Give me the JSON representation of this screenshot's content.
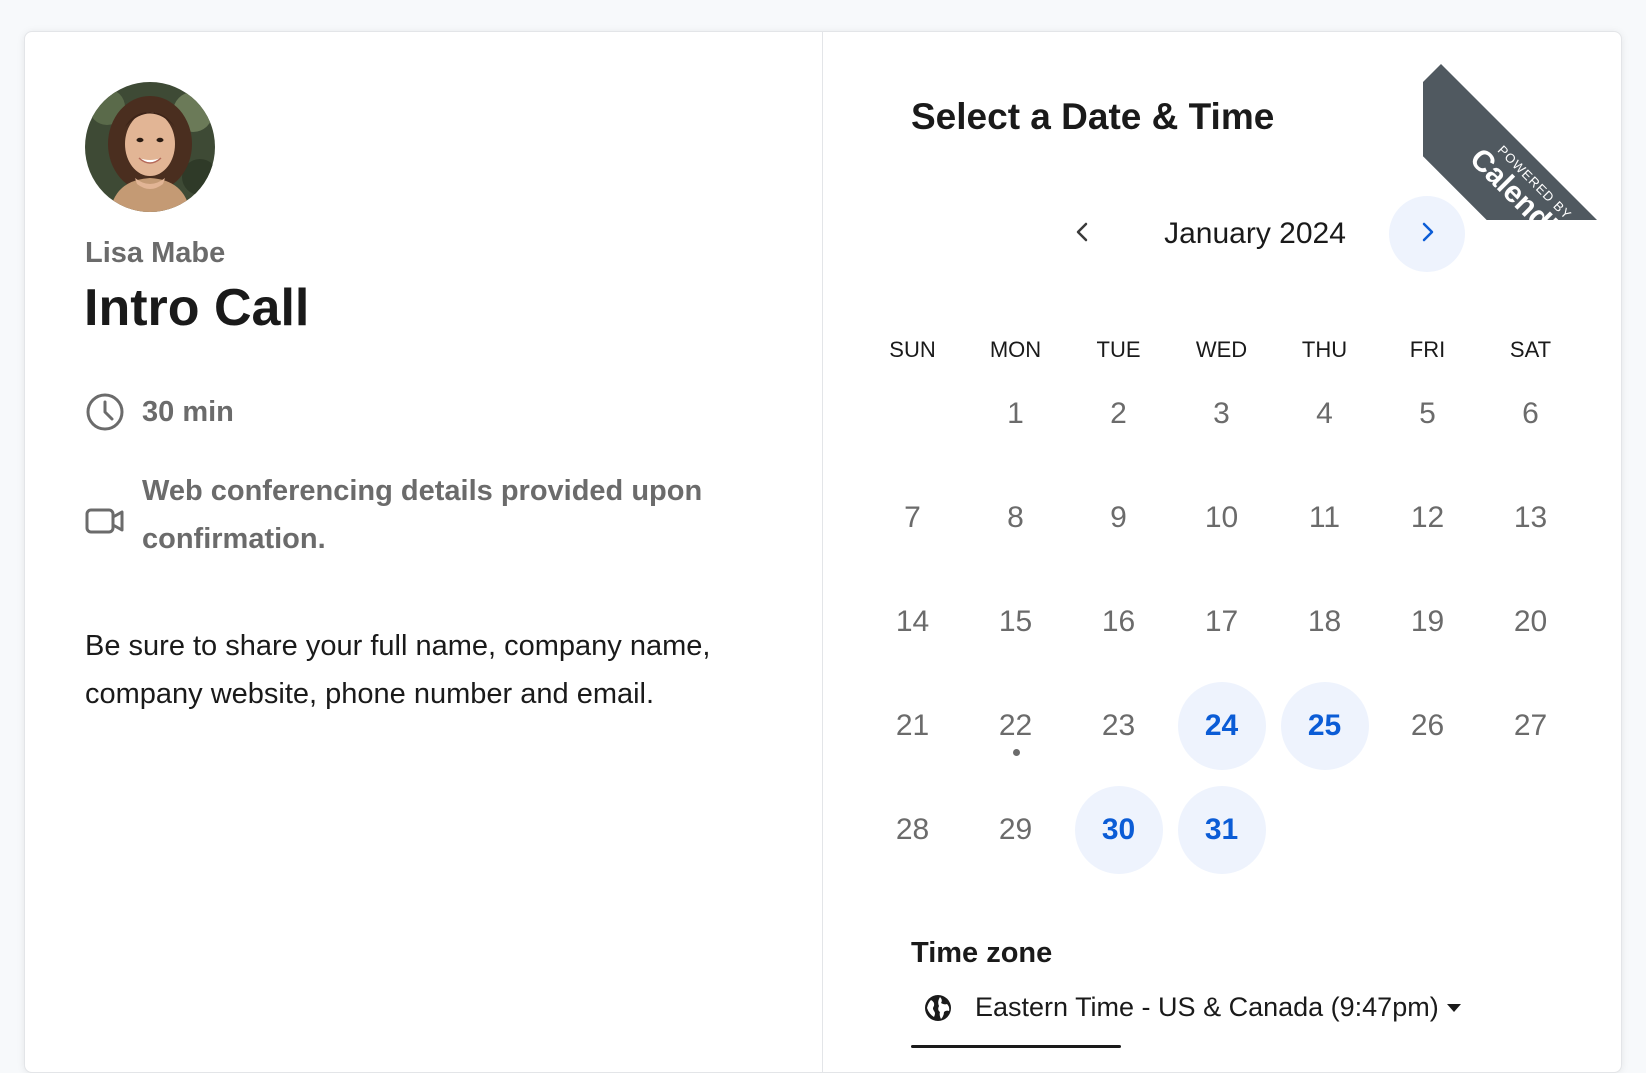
{
  "host": {
    "name": "Lisa Mabe"
  },
  "event": {
    "title": "Intro Call",
    "duration": "30 min",
    "conferencing": "Web conferencing details provided upon confirmation.",
    "description": "Be sure to share your full name, company name, company website, phone number and email."
  },
  "scheduler": {
    "title": "Select a Date & Time",
    "month_label": "January 2024",
    "weekdays": [
      "SUN",
      "MON",
      "TUE",
      "WED",
      "THU",
      "FRI",
      "SAT"
    ],
    "leading_blanks": 1,
    "days": [
      {
        "n": "1"
      },
      {
        "n": "2"
      },
      {
        "n": "3"
      },
      {
        "n": "4"
      },
      {
        "n": "5"
      },
      {
        "n": "6"
      },
      {
        "n": "7"
      },
      {
        "n": "8"
      },
      {
        "n": "9"
      },
      {
        "n": "10"
      },
      {
        "n": "11"
      },
      {
        "n": "12"
      },
      {
        "n": "13"
      },
      {
        "n": "14"
      },
      {
        "n": "15"
      },
      {
        "n": "16"
      },
      {
        "n": "17"
      },
      {
        "n": "18"
      },
      {
        "n": "19"
      },
      {
        "n": "20"
      },
      {
        "n": "21"
      },
      {
        "n": "22",
        "today": true
      },
      {
        "n": "23"
      },
      {
        "n": "24",
        "available": true
      },
      {
        "n": "25",
        "available": true
      },
      {
        "n": "26"
      },
      {
        "n": "27"
      },
      {
        "n": "28"
      },
      {
        "n": "29"
      },
      {
        "n": "30",
        "available": true
      },
      {
        "n": "31",
        "available": true
      }
    ]
  },
  "timezone": {
    "title": "Time zone",
    "value": "Eastern Time - US & Canada (9:47pm)"
  },
  "ribbon": {
    "small": "POWERED BY",
    "brand": "Calendly"
  },
  "colors": {
    "accent": "#0b5cd6",
    "available_bg": "#eef3fd",
    "ribbon_bg": "#505960"
  },
  "icons": {
    "prev": "chevron-left-icon",
    "next": "chevron-right-icon",
    "duration": "clock-icon",
    "conferencing": "video-camera-icon",
    "timezone": "globe-icon"
  }
}
